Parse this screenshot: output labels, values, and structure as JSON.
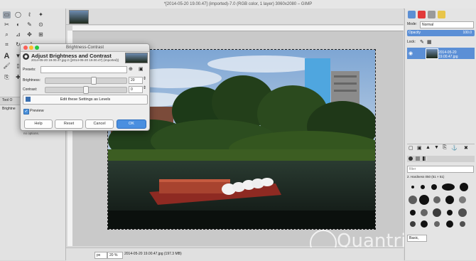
{
  "window": {
    "title": "*[2014-05-20 19.00.47] (imported)-7.0 (RGB color, 1 layer) 3060x2080 – GIMP"
  },
  "toolbox": {
    "tool_options_label": "Tool O",
    "brightness_label": "Brightne",
    "no_options_note": "This tool has no options."
  },
  "dialog": {
    "window_title": "Brightness-Contrast",
    "heading": "Adjust Brightness and Contrast",
    "subheading": "2014-05-20 19.00.47.jpg-2 ([2014-05-20 19.00.47] (imported))",
    "presets_label": "Presets:",
    "presets_value": "",
    "brightness_label": "Brightness:",
    "brightness_value": "20",
    "brightness_fraction": 0.6,
    "contrast_label": "Contrast:",
    "contrast_value": "0",
    "contrast_fraction": 0.5,
    "levels_button": "Edit these Settings as Levels",
    "preview_label": "Preview",
    "preview_checked": true,
    "buttons": {
      "help": "Help",
      "reset": "Reset",
      "cancel": "Cancel",
      "ok": "OK"
    }
  },
  "layers": {
    "mode_label": "Mode:",
    "mode_value": "Normal",
    "opacity_label": "Opacity",
    "opacity_value": "100.0",
    "lock_label": "Lock:",
    "layer_name": "2014-05-20 19.00.47.jpg"
  },
  "brushes": {
    "filter_value": "filter",
    "current_brush": "2. Hardness 050 (51 × 51)",
    "tag_value": "Basic,"
  },
  "statusbar": {
    "unit": "px",
    "zoom": "20 %",
    "file_info": "2014-05-20 19.00.47.jpg (197.3 MB)"
  },
  "watermark": {
    "text": "Quantrimang"
  },
  "colors": {
    "accent": "#4a90d9",
    "ok_button": "#4a8fe0",
    "selected_layer": "#5b8fd6"
  }
}
